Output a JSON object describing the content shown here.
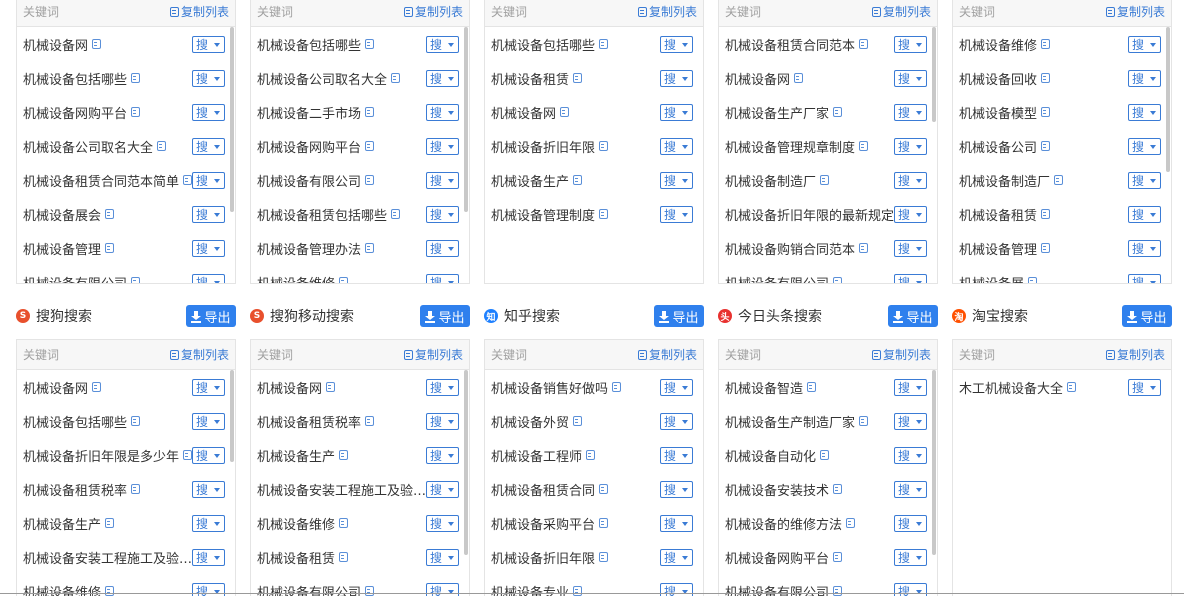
{
  "common": {
    "keyword_header": "关键词",
    "copy_list": "复制列表",
    "search_label": "搜",
    "export_label": "导出"
  },
  "top_cards": [
    {
      "keywords": [
        "机械设备网",
        "机械设备包括哪些",
        "机械设备网购平台",
        "机械设备公司取名大全",
        "机械设备租赁合同范本简单",
        "机械设备展会",
        "机械设备管理",
        "机械设备有限公司"
      ]
    },
    {
      "keywords": [
        "机械设备包括哪些",
        "机械设备公司取名大全",
        "机械设备二手市场",
        "机械设备网购平台",
        "机械设备有限公司",
        "机械设备租赁包括哪些",
        "机械设备管理办法",
        "机械设备维修"
      ]
    },
    {
      "keywords": [
        "机械设备包括哪些",
        "机械设备租赁",
        "机械设备网",
        "机械设备折旧年限",
        "机械设备生产",
        "机械设备管理制度"
      ]
    },
    {
      "keywords": [
        "机械设备租赁合同范本",
        "机械设备网",
        "机械设备生产厂家",
        "机械设备管理规章制度",
        "机械设备制造厂",
        "机械设备折旧年限的最新规定",
        "机械设备购销合同范本",
        "机械设备有限公司"
      ]
    },
    {
      "keywords": [
        "机械设备维修",
        "机械设备回收",
        "机械设备模型",
        "机械设备公司",
        "机械设备制造厂",
        "机械设备租赁",
        "机械设备管理",
        "机械设备展"
      ]
    }
  ],
  "sections": [
    {
      "title": "搜狗搜索",
      "logo_color": "#e8502d",
      "logo_char": "S",
      "keywords": [
        "机械设备网",
        "机械设备包括哪些",
        "机械设备折旧年限是多少年",
        "机械设备租赁税率",
        "机械设备生产",
        "机械设备安装工程施工及验收规范",
        "机械设备维修"
      ]
    },
    {
      "title": "搜狗移动搜索",
      "logo_color": "#e8502d",
      "logo_char": "S",
      "keywords": [
        "机械设备网",
        "机械设备租赁税率",
        "机械设备生产",
        "机械设备安装工程施工及验收规范",
        "机械设备维修",
        "机械设备租赁",
        "机械设备有限公司"
      ]
    },
    {
      "title": "知乎搜索",
      "logo_color": "#1e80ff",
      "logo_char": "知",
      "keywords": [
        "机械设备销售好做吗",
        "机械设备外贸",
        "机械设备工程师",
        "机械设备租赁合同",
        "机械设备采购平台",
        "机械设备折旧年限",
        "机械设备专业"
      ]
    },
    {
      "title": "今日头条搜索",
      "logo_color": "#e8312f",
      "logo_char": "头",
      "keywords": [
        "机械设备智造",
        "机械设备生产制造厂家",
        "机械设备自动化",
        "机械设备安装技术",
        "机械设备的维修方法",
        "机械设备网购平台",
        "机械设备有限公司"
      ]
    },
    {
      "title": "淘宝搜索",
      "logo_color": "#ff5000",
      "logo_char": "淘",
      "keywords": [
        "木工机械设备大全"
      ]
    }
  ]
}
